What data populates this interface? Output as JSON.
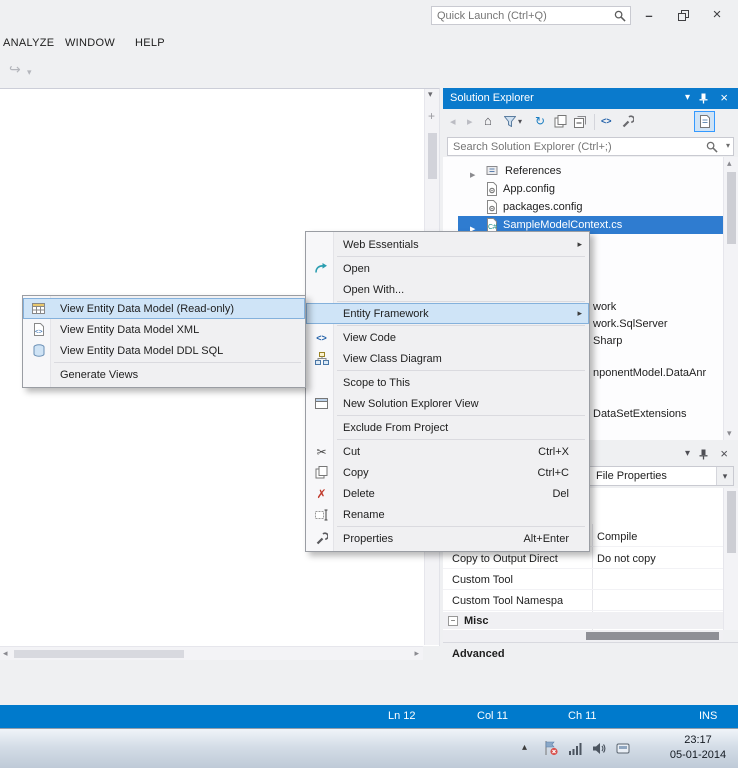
{
  "titlebar": {
    "quick_launch": "Quick Launch (Ctrl+Q)"
  },
  "menubar": {
    "items": [
      {
        "label": "ANALYZE"
      },
      {
        "label": "WINDOW"
      },
      {
        "label": "HELP"
      }
    ]
  },
  "solution_explorer": {
    "title": "Solution Explorer",
    "search_placeholder": "Search Solution Explorer (Ctrl+;)",
    "tree": [
      {
        "label": "References"
      },
      {
        "label": "App.config"
      },
      {
        "label": "packages.config"
      },
      {
        "label": "SampleModelContext.cs"
      }
    ],
    "clipped_labels": [
      {
        "label": "work"
      },
      {
        "label": "work.SqlServer"
      },
      {
        "label": "Sharp"
      },
      {
        "label": "nponentModel.DataAnr"
      },
      {
        "label": "DataSetExtensions"
      }
    ]
  },
  "context_menu": {
    "items": [
      {
        "label": "Web Essentials"
      },
      {
        "label": "Open"
      },
      {
        "label": "Open With..."
      },
      {
        "label": "Entity Framework"
      },
      {
        "label": "View Code"
      },
      {
        "label": "View Class Diagram"
      },
      {
        "label": "Scope to This"
      },
      {
        "label": "New Solution Explorer View"
      },
      {
        "label": "Exclude From Project"
      },
      {
        "label": "Cut",
        "shortcut": "Ctrl+X"
      },
      {
        "label": "Copy",
        "shortcut": "Ctrl+C"
      },
      {
        "label": "Delete",
        "shortcut": "Del"
      },
      {
        "label": "Rename"
      },
      {
        "label": "Properties",
        "shortcut": "Alt+Enter"
      }
    ]
  },
  "ef_submenu": {
    "items": [
      {
        "label": "View Entity Data Model (Read-only)"
      },
      {
        "label": "View Entity Data Model XML"
      },
      {
        "label": "View Entity Data Model DDL SQL"
      },
      {
        "label": "Generate Views"
      }
    ]
  },
  "properties_panel": {
    "combo_text": "File Properties",
    "rows": [
      {
        "label": "",
        "value": "Compile"
      },
      {
        "label": "Copy to Output Direct",
        "value": "Do not copy"
      },
      {
        "label": "Custom Tool",
        "value": ""
      },
      {
        "label": "Custom Tool Namespa",
        "value": ""
      }
    ],
    "category_row": "Misc",
    "help_title": "Advanced"
  },
  "status_bar": {
    "line": "Ln 12",
    "column": "Col 11",
    "character": "Ch 11",
    "mode": "INS"
  },
  "system_tray": {
    "time": "23:17",
    "date": "05-01-2014"
  },
  "icons": {
    "dropdown": "▾",
    "submenu_arrow": "▸",
    "expander": "▶",
    "close": "×",
    "minimize": "–",
    "home": "⌂",
    "refresh": "↻",
    "cut": "✂",
    "delete": "✗",
    "code": "<>",
    "csharp": "C#",
    "back": "◂",
    "forward": "▸",
    "up": "▴",
    "down": "▾",
    "left": "◂",
    "right": "▸",
    "plus_grip": "+",
    "minus": "−",
    "tray_expand": "▴",
    "nav_forward": "↪"
  }
}
